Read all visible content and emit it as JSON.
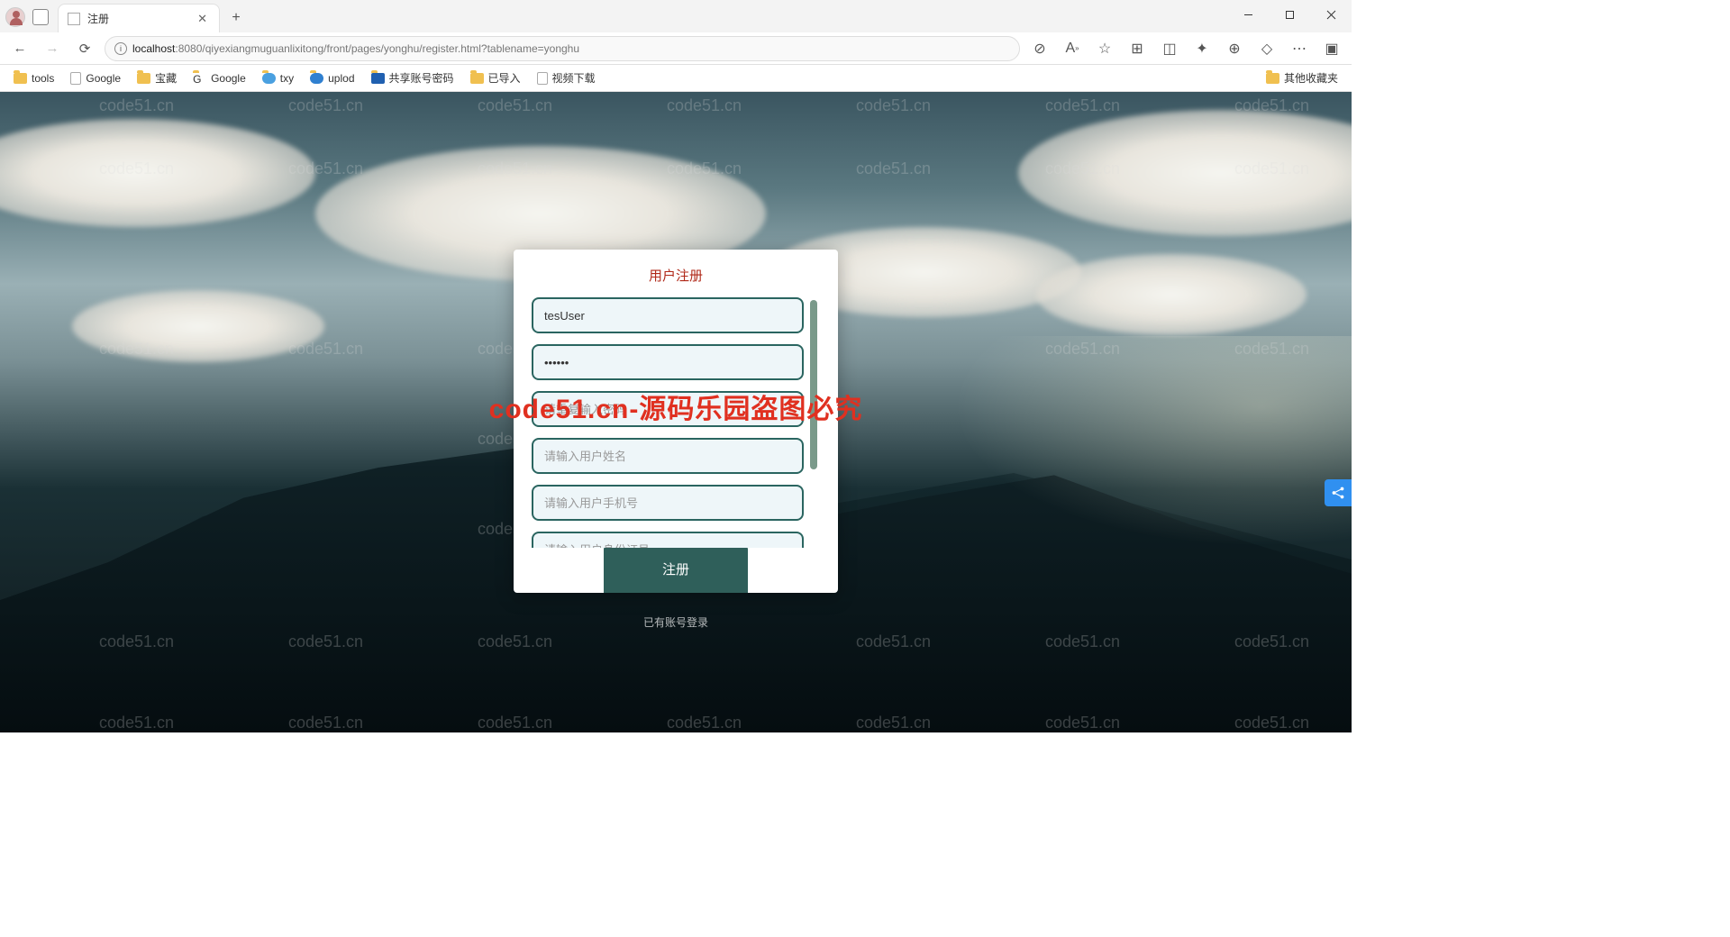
{
  "browser": {
    "tab_title": "注册",
    "url_host": "localhost",
    "url_port": ":8080",
    "url_path": "/qiyexiangmuguanlixitong/front/pages/yonghu/register.html?tablename=yonghu",
    "bookmarks": [
      "tools",
      "Google",
      "宝藏",
      "Google",
      "txy",
      "uplod",
      "共享账号密码",
      "已导入",
      "视频下载"
    ],
    "other_bookmarks": "其他收藏夹"
  },
  "watermark_small": "code51.cn",
  "watermark_big": "code51.cn-源码乐园盗图必究",
  "form": {
    "title": "用户注册",
    "username_value": "tesUser",
    "password_value": "••••••",
    "confirm_placeholder": "请重复输入密码",
    "name_placeholder": "请输入用户姓名",
    "phone_placeholder": "请输入用户手机号",
    "idcard_placeholder": "请输入用户身份证号",
    "submit_label": "注册",
    "login_link": "已有账号登录"
  }
}
